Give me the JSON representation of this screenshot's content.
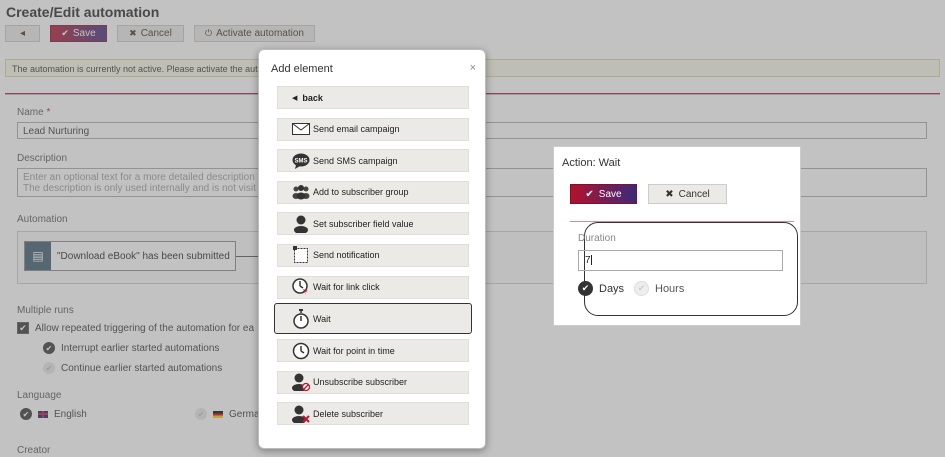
{
  "page": {
    "title": "Create/Edit automation",
    "toolbar": {
      "save_label": "Save",
      "cancel_label": "Cancel",
      "activate_label": "Activate automation"
    },
    "notice": "The automation is currently not active. Please activate the autom",
    "name_label": "Name",
    "name_value": "Lead Nurturing",
    "description_label": "Description",
    "description_placeholder_line1": "Enter an optional text for a more detailed description",
    "description_placeholder_line2": "The description is only used internally and is not visit",
    "automation_label": "Automation",
    "trigger_text": "\"Download eBook\" has been submitted",
    "multiple_runs_label": "Multiple runs",
    "allow_repeated": "Allow repeated triggering of the automation for ea",
    "interrupt_option": "Interrupt earlier started automations",
    "continue_option": "Continue earlier started automations",
    "language_label": "Language",
    "lang_english": "English",
    "lang_german": "Germa",
    "creator_label": "Creator"
  },
  "dialog": {
    "title": "Add element",
    "close": "×",
    "items": [
      {
        "label": "back",
        "icon": "chevron-left-icon"
      },
      {
        "label": "Send email campaign",
        "icon": "envelope-icon"
      },
      {
        "label": "Send SMS campaign",
        "icon": "sms-icon"
      },
      {
        "label": "Add to subscriber group",
        "icon": "group-icon"
      },
      {
        "label": "Set subscriber field value",
        "icon": "user-icon"
      },
      {
        "label": "Send notification",
        "icon": "notification-icon"
      },
      {
        "label": "Wait for link click",
        "icon": "clock-click-icon"
      },
      {
        "label": "Wait",
        "icon": "stopwatch-icon"
      },
      {
        "label": "Wait for point in time",
        "icon": "clock-icon"
      },
      {
        "label": "Unsubscribe subscriber",
        "icon": "user-unsubscribe-icon"
      },
      {
        "label": "Delete subscriber",
        "icon": "user-delete-icon"
      }
    ]
  },
  "wait_panel": {
    "title": "Action: Wait",
    "save_label": "Save",
    "cancel_label": "Cancel",
    "duration_label": "Duration",
    "duration_value": "7",
    "unit_days": "Days",
    "unit_hours": "Hours"
  },
  "colors": {
    "save_gradient_start": "#b3122a",
    "save_gradient_end": "#3b2a7a",
    "item_bg": "#eceae6"
  }
}
